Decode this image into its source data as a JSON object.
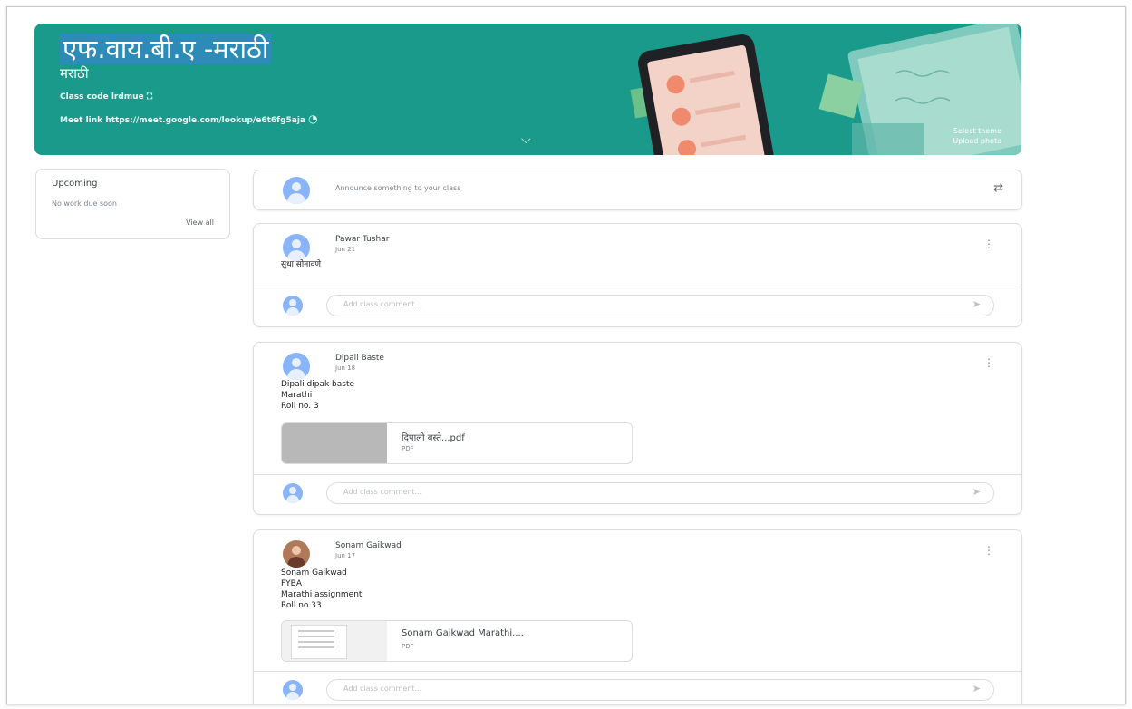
{
  "banner": {
    "title": "एफ.वाय.बी.ए -मराठी",
    "subtitle": "मराठी",
    "class_code_label": "Class code",
    "class_code": "lrdmue",
    "meet_link_label": "Meet link",
    "meet_link": "https://meet.google.com/lookup/e6t6fg5aja",
    "theme_line1": "Select theme",
    "theme_line2": "Upload photo",
    "color": "#1a9a8a"
  },
  "upcoming": {
    "heading": "Upcoming",
    "none_text": "No work due soon",
    "view_all": "View all"
  },
  "announce": {
    "placeholder": "Announce something to your class"
  },
  "posts": [
    {
      "author": "Pawar Tushar",
      "date": "Jun 21",
      "body": [
        "सुधा सोनावणे"
      ],
      "comment_placeholder": "Add class comment..."
    },
    {
      "author": "Dipali Baste",
      "date": "Jun 18",
      "body": [
        "Dipali dipak baste",
        "Marathi",
        "Roll no. 3"
      ],
      "attachment": {
        "name": "दिपाली बस्ते...pdf",
        "type": "PDF"
      },
      "comment_placeholder": "Add class comment..."
    },
    {
      "author": "Sonam Gaikwad",
      "date": "Jun 17",
      "body": [
        "Sonam Gaikwad",
        "FYBA",
        "Marathi assignment",
        "Roll no.33"
      ],
      "attachment": {
        "name": "Sonam Gaikwad Marathi....",
        "type": "PDF"
      },
      "comment_placeholder": "Add class comment..."
    }
  ]
}
